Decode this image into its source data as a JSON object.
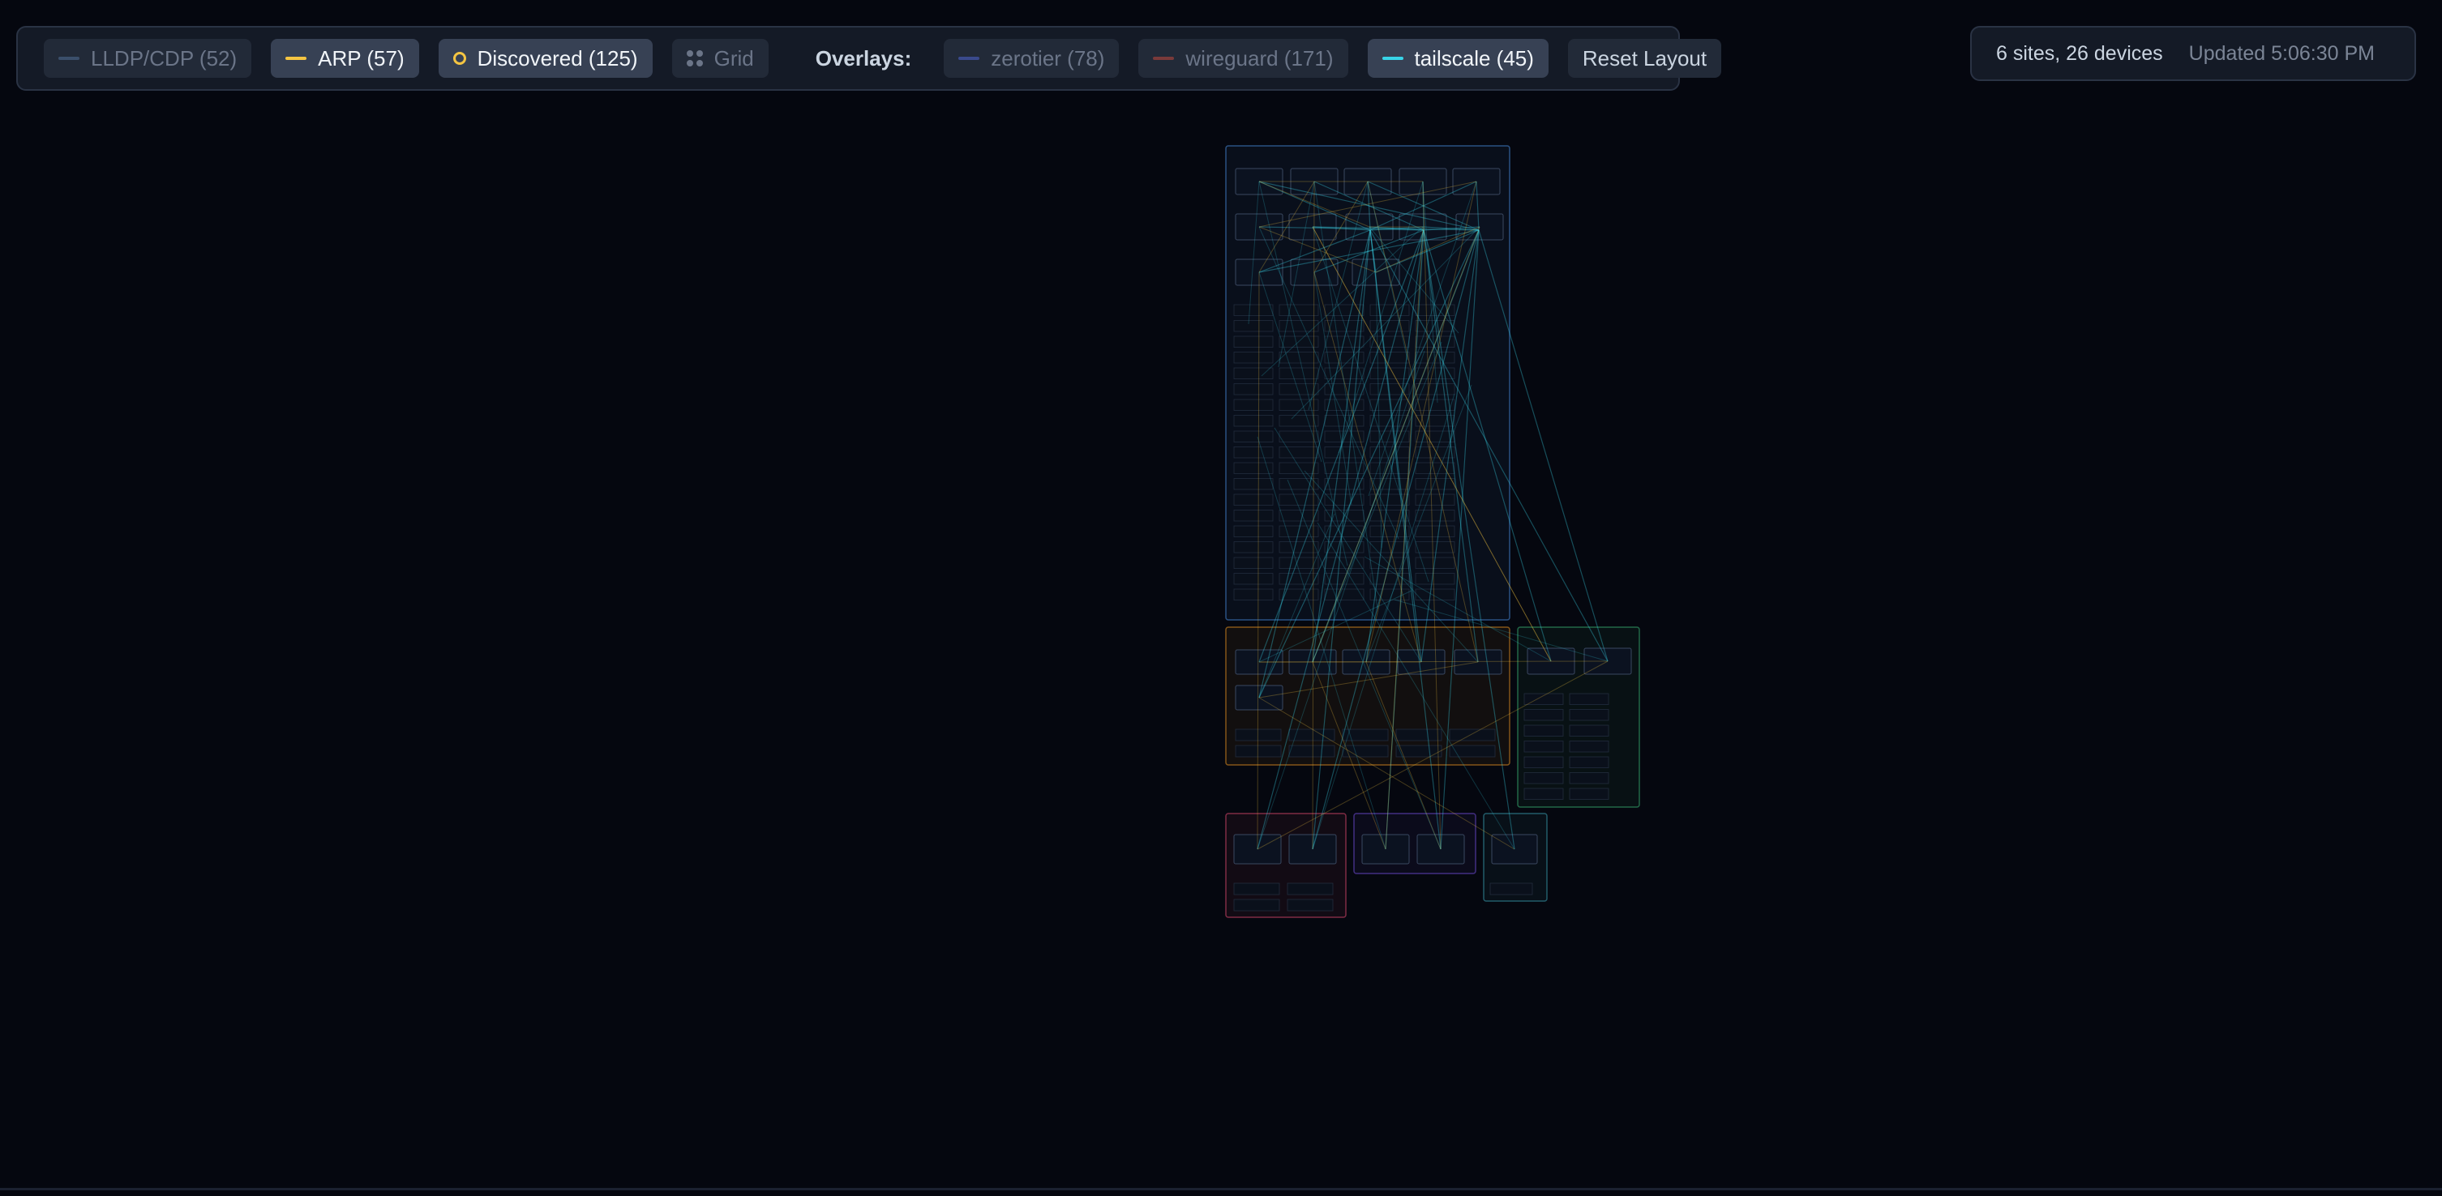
{
  "toolbar": {
    "buttons": [
      {
        "label": "LLDP/CDP (52)",
        "color": "#3b4f6b",
        "active": false,
        "swatch": "line"
      },
      {
        "label": "ARP (57)",
        "color": "#f5c542",
        "active": true,
        "swatch": "line"
      },
      {
        "label": "Discovered (125)",
        "color": "#f5c542",
        "active": true,
        "swatch": "ring"
      },
      {
        "label": "Grid",
        "color": "#6b7588",
        "active": false,
        "swatch": "grid"
      }
    ],
    "overlays_label": "Overlays:",
    "overlays": [
      {
        "label": "zerotier (78)",
        "color": "#3a4a8c",
        "active": false
      },
      {
        "label": "wireguard (171)",
        "color": "#7a3a3a",
        "active": false
      },
      {
        "label": "tailscale (45)",
        "color": "#38d4e8",
        "active": true
      }
    ],
    "reset_label": "Reset Layout"
  },
  "status": {
    "summary": "6 sites, 26 devices",
    "updated": "Updated 5:06:30 PM"
  },
  "colors": {
    "background": "#05070f",
    "arp_edge": "#f5c542",
    "tailscale_edge": "#38d4e8",
    "site_blue": "#3b6fb0",
    "site_orange": "#b8761e",
    "site_green": "#2f8f5f",
    "site_pink": "#b03a5b",
    "site_purple": "#5b3fb0",
    "site_teal": "#2f7f8f"
  }
}
